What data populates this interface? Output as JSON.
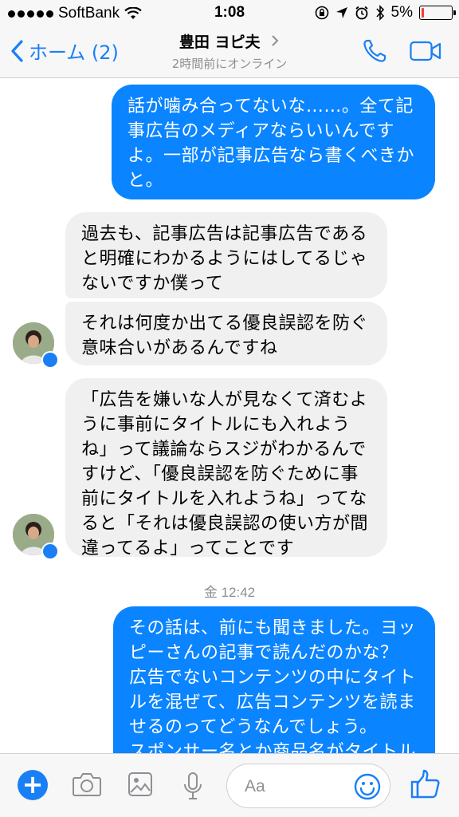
{
  "status": {
    "carrier": "SoftBank",
    "time": "1:08",
    "battery": "5%",
    "battery_level": 0.05
  },
  "nav": {
    "back_label": "ホーム (2)",
    "contact_name": "豊田 ヨピ夫",
    "last_seen": "2時間前にオンライン"
  },
  "messages": [
    {
      "direction": "out",
      "lines": [
        "話が噛み合ってないな……。全て記",
        "事広告のメディアならいいんです",
        "よ。一部が記事広告なら書くべきか",
        "と。"
      ]
    },
    {
      "direction": "in",
      "lines": [
        "過去も、記事広告は記事広告である",
        "と明確にわかるようにはしてるじゃ",
        "ないですか僕って"
      ]
    },
    {
      "direction": "in",
      "lines": [
        "それは何度か出てる優良誤認を防ぐ",
        "意味合いがあるんですね"
      ]
    },
    {
      "direction": "in",
      "lines": [
        "「広告を嫌いな人が見なくて済むよ",
        "うに事前にタイトルにも入れよう",
        "ね」って議論ならスジがわかるんで",
        "すけど、「優良誤認を防ぐために事",
        "前にタイトルを入れようね」ってな",
        "ると「それは優良誤認の使い方が間",
        "違ってるよ」ってことです"
      ]
    },
    {
      "direction": "out",
      "lines": [
        "その話は、前にも聞きました。ヨッ",
        "ピーさんの記事で読んだのかな？",
        "広告でないコンテンツの中にタイト",
        "ルを混ぜて、広告コンテンツを読ま",
        "せるのってどうなんでしょう。",
        "スポンサー名とか商品名がタイトル"
      ]
    }
  ],
  "timestamp": "金 12:42",
  "composer": {
    "placeholder": "Aa"
  },
  "colors": {
    "accent": "#1a7ff5",
    "outgoing_bubble": "#0a84ff",
    "incoming_bubble": "#f1f0f0"
  },
  "icons": [
    "back-chevron-icon",
    "phone-icon",
    "video-call-icon",
    "messenger-badge-icon",
    "plus-icon",
    "camera-icon",
    "gallery-icon",
    "microphone-icon",
    "emoji-icon",
    "thumbs-up-icon"
  ]
}
